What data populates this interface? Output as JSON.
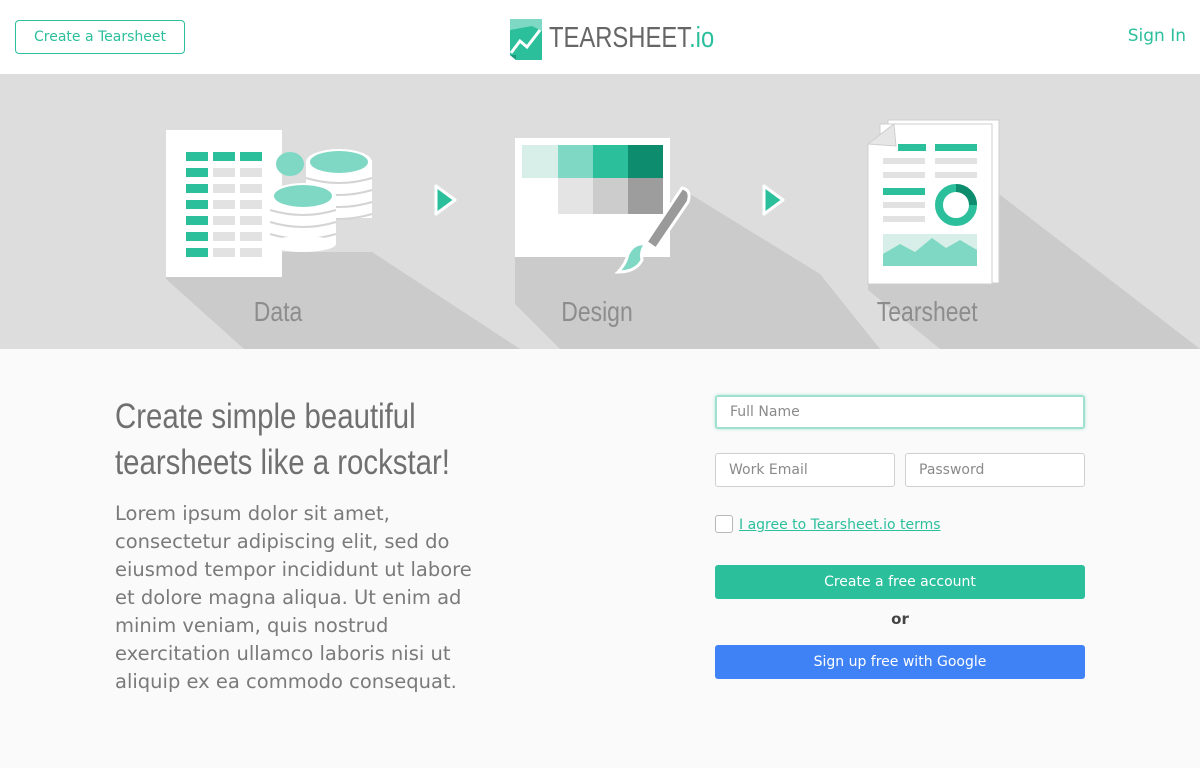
{
  "header": {
    "create_button_label": "Create a Tearsheet",
    "logo_text": "TEARSHEET",
    "logo_suffix": ".io",
    "signin_label": "Sign In"
  },
  "hero": {
    "steps": [
      {
        "label": "Data",
        "icon": "spreadsheet-coins-icon"
      },
      {
        "label": "Design",
        "icon": "palette-brush-icon"
      },
      {
        "label": "Tearsheet",
        "icon": "report-document-icon"
      }
    ],
    "arrow_icon": "play-arrow-icon"
  },
  "main": {
    "headline_line1": "Create simple beautiful",
    "headline_line2": "tearsheets like a rockstar!",
    "body": "Lorem ipsum dolor sit amet, consectetur adipiscing elit, sed do eiusmod tempor incididunt ut labore et dolore magna aliqua. Ut enim ad minim veniam, quis nostrud exercitation ullamco laboris nisi ut aliquip ex ea commodo consequat."
  },
  "form": {
    "full_name_placeholder": "Full Name",
    "full_name_value": "",
    "email_placeholder": "Work Email",
    "email_value": "",
    "password_placeholder": "Password",
    "password_value": "",
    "terms_label": "I agree to Tearsheet.io terms",
    "terms_checked": false,
    "submit_label": "Create a free account",
    "or_label": "or",
    "google_label": "Sign up free with Google"
  },
  "colors": {
    "accent": "#2bbf9c",
    "google_blue": "#3f82f5",
    "hero_bg": "#dddddd",
    "page_bg": "#fafafa"
  }
}
